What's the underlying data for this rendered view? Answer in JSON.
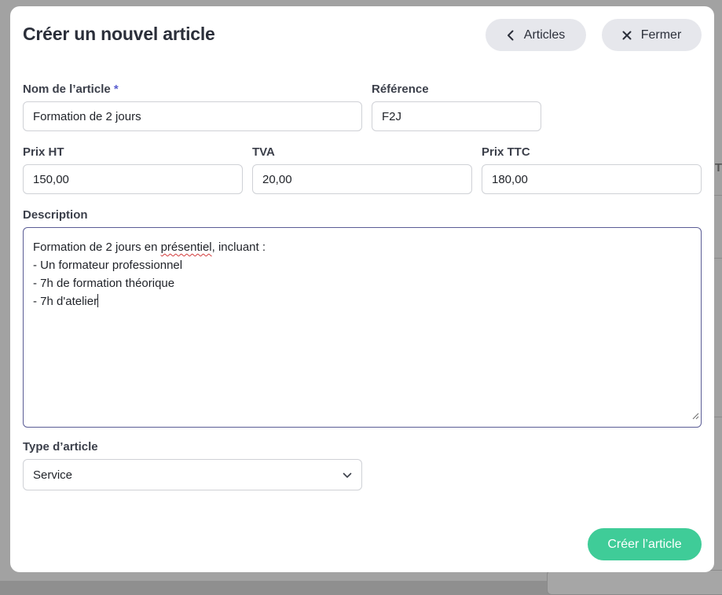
{
  "modal": {
    "title": "Créer un nouvel article",
    "articles_button": "Articles",
    "close_button": "Fermer"
  },
  "form": {
    "name_label": "Nom de l’article",
    "required_mark": "*",
    "name_value": "Formation de 2 jours",
    "reference_label": "Référence",
    "reference_value": "F2J",
    "price_ht_label": "Prix HT",
    "price_ht_value": "150,00",
    "tva_label": "TVA",
    "tva_value": "20,00",
    "price_ttc_label": "Prix TTC",
    "price_ttc_value": "180,00",
    "description_label": "Description",
    "description": {
      "line1_before": "Formation de 2 jours en ",
      "line1_misspelled": "présentiel",
      "line1_after": ", incluant :",
      "line2": "- Un formateur professionnel",
      "line3": "- 7h de formation théorique",
      "line4": "- 7h d'atelier"
    },
    "type_label": "Type d’article",
    "type_value": "Service",
    "submit_button": "Créer l’article"
  },
  "background": {
    "edge_text": "T"
  },
  "colors": {
    "primary_button": "#3fcc98",
    "secondary_button": "#e6e7ec",
    "focus_border": "#5a5c95",
    "required_mark": "#5a5fcf",
    "spellcheck_underline": "#d23b3b"
  },
  "icons": {
    "articles_button": "chevron-left-icon",
    "close_button": "close-icon",
    "type_select": "chevron-down-icon",
    "textarea": "resize-grip-icon"
  }
}
